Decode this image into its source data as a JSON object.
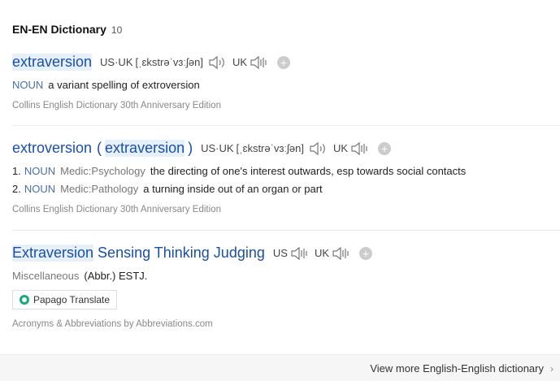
{
  "header": {
    "title": "EN-EN Dictionary",
    "count": "10"
  },
  "entries": [
    {
      "word": "extraversion",
      "pron_region": "US·UK",
      "pron_ipa": "[ˌɛkstrəˈvɜːʃən]",
      "uk_label": "UK",
      "def": {
        "pos": "NOUN",
        "text": "a variant spelling of extroversion"
      },
      "source": "Collins English Dictionary 30th Anniversary Edition"
    },
    {
      "word": "extroversion",
      "paren_open": "(",
      "variant": "extraversion",
      "paren_close": ")",
      "pron_region": "US·UK",
      "pron_ipa": "[ˌɛkstrəˈvɜːʃən]",
      "uk_label": "UK",
      "defs": [
        {
          "num": "1.",
          "pos": "NOUN",
          "tag": "Medic:Psychology",
          "text": "the directing of one's interest outwards, esp towards social contacts"
        },
        {
          "num": "2.",
          "pos": "NOUN",
          "tag": "Medic:Pathology",
          "text": "a turning inside out of an organ or part"
        }
      ],
      "source": "Collins English Dictionary 30th Anniversary Edition"
    },
    {
      "word_highlight": "Extraversion",
      "word_rest": "Sensing Thinking Judging",
      "us_label": "US",
      "uk_label": "UK",
      "misc_label": "Miscellaneous",
      "def_text": "(Abbr.) ESTJ.",
      "translate_button": "Papago Translate",
      "source": "Acronyms & Abbreviations by Abbreviations.com"
    }
  ],
  "footer": {
    "more_link": "View more English-English dictionary"
  },
  "colors": {
    "link_blue": "#1b4fa5",
    "highlight": "#e6f0fb",
    "muted": "#888888"
  },
  "icons": [
    "speaker-icon",
    "add-icon",
    "papago-logo-icon",
    "chevron-right-icon"
  ]
}
